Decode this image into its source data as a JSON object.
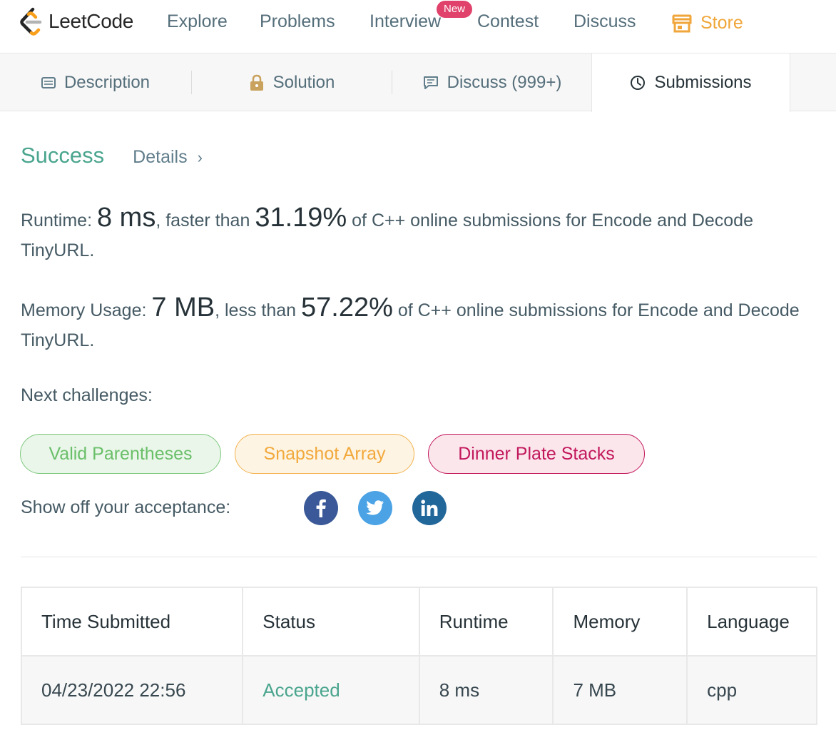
{
  "nav": {
    "logo_text": "LeetCode",
    "links": [
      "Explore",
      "Problems",
      "Interview",
      "Contest",
      "Discuss"
    ],
    "new_badge": "New",
    "store": "Store",
    "colors": {
      "store": "#f0a63a",
      "badge": "#e0426b"
    }
  },
  "tabs": {
    "description": "Description",
    "solution": "Solution",
    "discuss": "Discuss (999+)",
    "submissions": "Submissions",
    "active": "Submissions"
  },
  "result": {
    "status": "Success",
    "details": "Details",
    "chevron": "›",
    "runtime": {
      "label": "Runtime: ",
      "value": "8 ms",
      "mid": ", faster than ",
      "percent": "31.19%",
      "tail": " of C++ online submissions for Encode and Decode TinyURL."
    },
    "memory": {
      "label": "Memory Usage: ",
      "value": "7 MB",
      "mid": ", less than ",
      "percent": "57.22%",
      "tail": " of C++ online submissions for Encode and Decode TinyURL."
    }
  },
  "next_challenges": {
    "label": "Next challenges:",
    "items": [
      "Valid Parentheses",
      "Snapshot Array",
      "Dinner Plate Stacks"
    ]
  },
  "share": {
    "label": "Show off your acceptance:",
    "icons": [
      "facebook-icon",
      "twitter-icon",
      "linkedin-icon"
    ]
  },
  "table": {
    "headers": [
      "Time Submitted",
      "Status",
      "Runtime",
      "Memory",
      "Language"
    ],
    "rows": [
      [
        "04/23/2022 22:56",
        "Accepted",
        "8 ms",
        "7 MB",
        "cpp"
      ]
    ]
  }
}
